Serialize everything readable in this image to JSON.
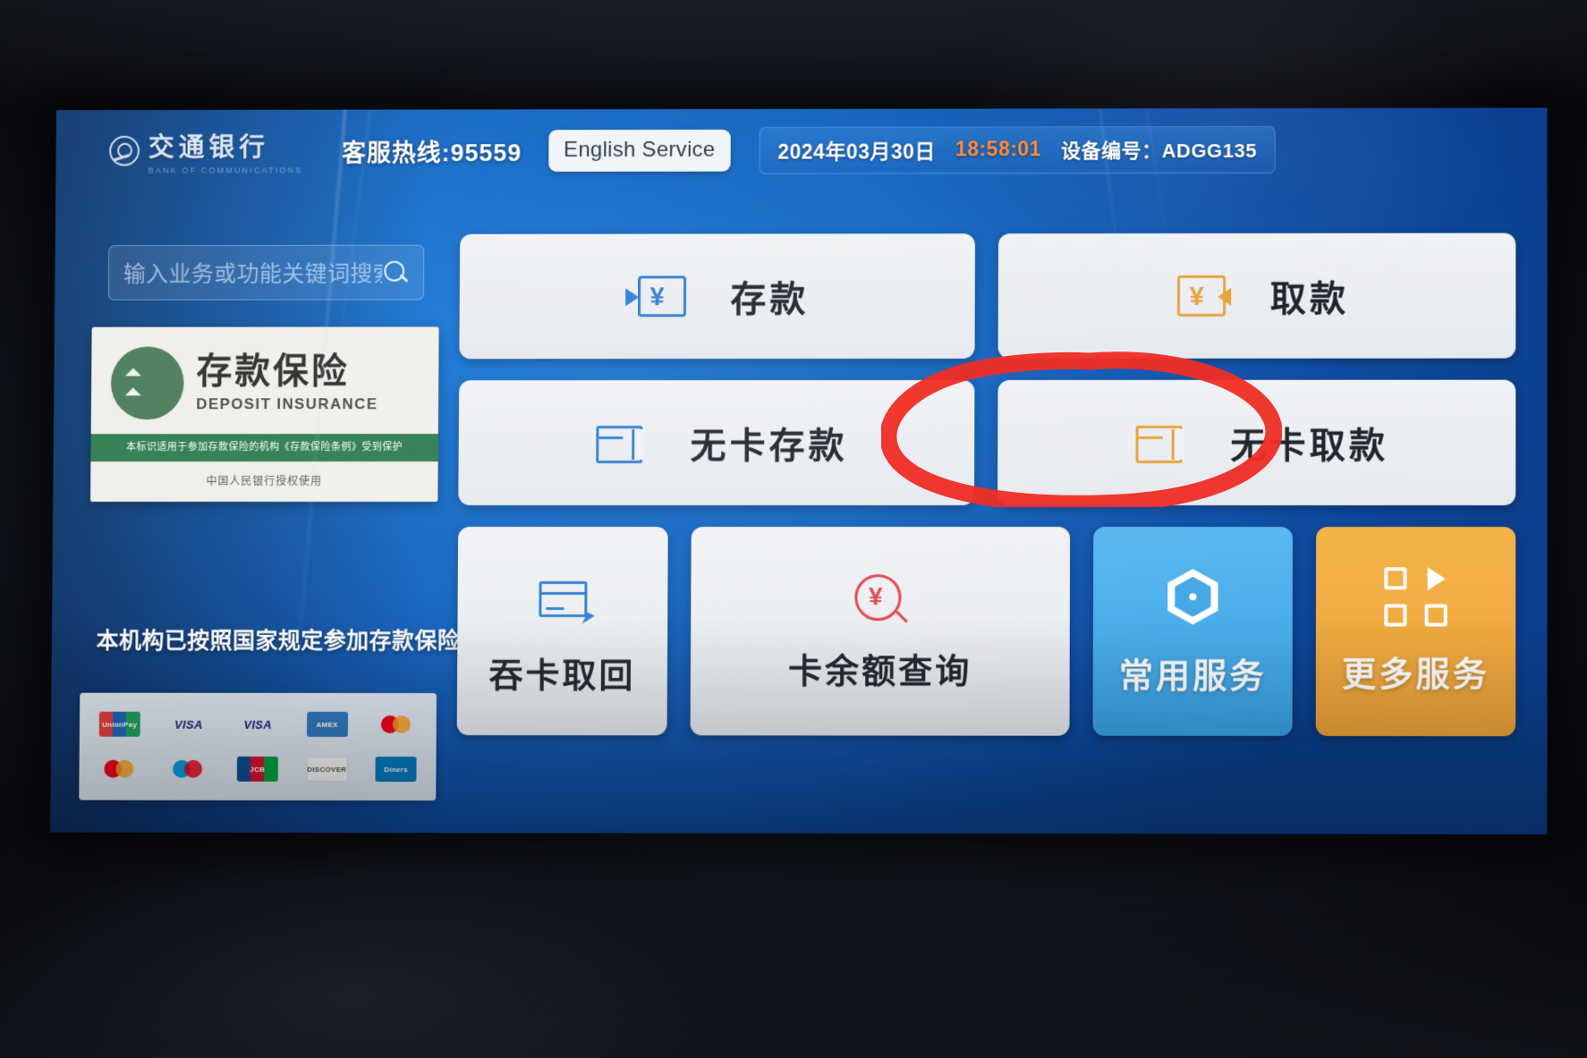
{
  "header": {
    "bank_name": "交通银行",
    "bank_name_en": "BANK OF COMMUNICATIONS",
    "hotline": "客服热线:95559",
    "english_service": "English Service",
    "date": "2024年03月30日",
    "time": "18:58:01",
    "device_id": "设备编号：ADGG135",
    "time_color": "#ff8a3d"
  },
  "sidebar": {
    "search_placeholder": "输入业务或功能关键词搜索...",
    "insurance_card": {
      "title_cn": "存款保险",
      "title_en": "DEPOSIT INSURANCE",
      "green_band": "本标识适用于参加存款保险的机构《存款保险条例》受到保护",
      "footer": "中国人民银行授权使用"
    },
    "insurance_notice": "本机构已按照国家规定参加存款保险",
    "card_logos": [
      "unionpay",
      "visa",
      "visa",
      "amex",
      "mastercard",
      "mastercard",
      "maestro",
      "jcb",
      "discover",
      "diners"
    ]
  },
  "menu": {
    "rows": [
      [
        {
          "label": "存款",
          "icon": "deposit-icon",
          "style": "big",
          "color": "#2f7fd4"
        },
        {
          "label": "取款",
          "icon": "withdraw-icon",
          "style": "big",
          "color": "#e8a33c"
        }
      ],
      [
        {
          "label": "无卡存款",
          "icon": "cardless-deposit-icon",
          "style": "big",
          "color": "#2f7fd4"
        },
        {
          "label": "无卡取款",
          "icon": "cardless-withdraw-icon",
          "style": "big",
          "color": "#e8a33c"
        }
      ],
      [
        {
          "label": "吞卡取回",
          "icon": "retrieve-card-icon",
          "style": "sq",
          "color": "#2f7fd4"
        },
        {
          "label": "卡余额查询",
          "icon": "balance-inquiry-icon",
          "style": "wide2",
          "color": "#e0464e"
        },
        {
          "label": "常用服务",
          "icon": "common-services-icon",
          "style": "accent-blue",
          "color": "#45a8e6"
        },
        {
          "label": "更多服务",
          "icon": "more-services-icon",
          "style": "accent-orange",
          "color": "#eda238"
        }
      ]
    ]
  },
  "annotation": {
    "type": "red-ellipse-marker",
    "target": "无卡取款",
    "color": "#ef2d24"
  }
}
